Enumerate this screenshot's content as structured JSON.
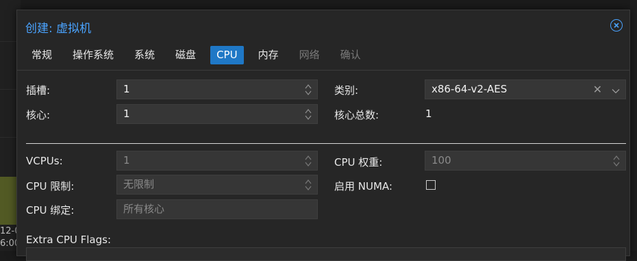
{
  "background": {
    "tick_line1": "12-0",
    "tick_line2": "6:00"
  },
  "dialog": {
    "title": "创建: 虚拟机",
    "close_icon": "close-circle-icon"
  },
  "tabs": [
    {
      "label": "常规",
      "state": "normal"
    },
    {
      "label": "操作系统",
      "state": "normal"
    },
    {
      "label": "系统",
      "state": "normal"
    },
    {
      "label": "磁盘",
      "state": "normal"
    },
    {
      "label": "CPU",
      "state": "active"
    },
    {
      "label": "内存",
      "state": "normal"
    },
    {
      "label": "网络",
      "state": "disabled"
    },
    {
      "label": "确认",
      "state": "disabled"
    }
  ],
  "form": {
    "sockets_label": "插槽:",
    "sockets_value": "1",
    "cores_label": "核心:",
    "cores_value": "1",
    "type_label": "类别:",
    "type_value": "x86-64-v2-AES",
    "total_cores_label": "核心总数:",
    "total_cores_value": "1",
    "vcpus_label": "VCPUs:",
    "vcpus_value": "1",
    "cpu_limit_label": "CPU 限制:",
    "cpu_limit_placeholder": "无限制",
    "cpu_affinity_label": "CPU 绑定:",
    "cpu_affinity_placeholder": "所有核心",
    "cpu_weight_label": "CPU 权重:",
    "cpu_weight_placeholder": "100",
    "numa_label": "启用 NUMA:",
    "numa_checked": false,
    "extra_flags_label": "Extra CPU Flags:"
  },
  "colors": {
    "accent": "#1f78c6",
    "title": "#4aa3ff"
  }
}
